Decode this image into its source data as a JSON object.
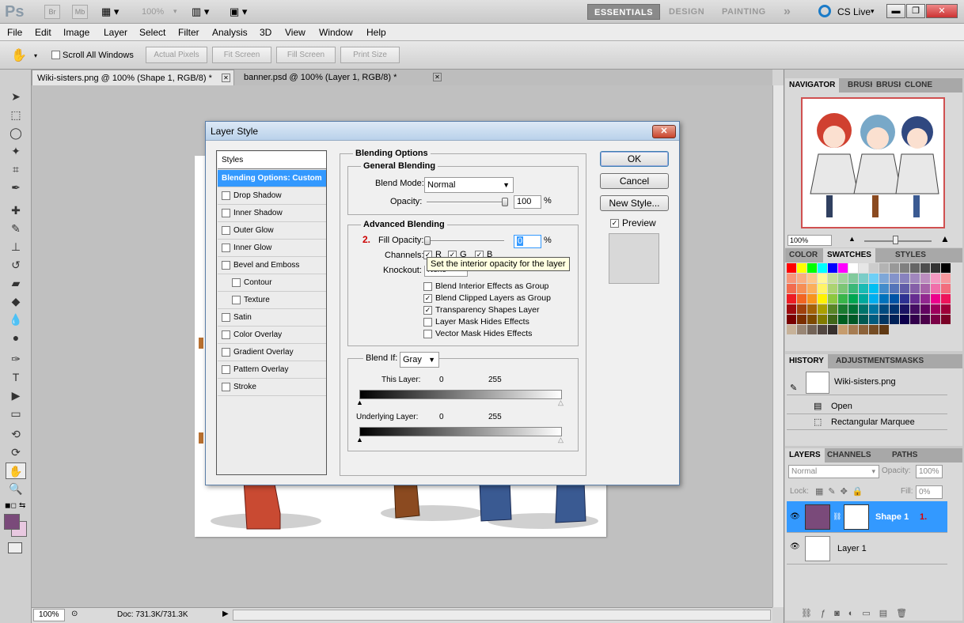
{
  "app": {
    "logo": "Ps",
    "br": "Br",
    "mb": "Mb",
    "zoom": "100%",
    "workspaces": [
      "ESSENTIALS",
      "DESIGN",
      "PAINTING"
    ],
    "more": "»",
    "cslive": "CS Live"
  },
  "menu": [
    "File",
    "Edit",
    "Image",
    "Layer",
    "Select",
    "Filter",
    "Analysis",
    "3D",
    "View",
    "Window",
    "Help"
  ],
  "options": {
    "scroll_all": "Scroll All Windows",
    "actual": "Actual Pixels",
    "fit": "Fit Screen",
    "fill": "Fill Screen",
    "print": "Print Size"
  },
  "tabs": [
    {
      "label": "Wiki-sisters.png @ 100% (Shape 1, RGB/8) *"
    },
    {
      "label": "banner.psd @ 100% (Layer 1, RGB/8) *"
    }
  ],
  "status": {
    "zoom": "100%",
    "doc": "Doc: 731.3K/731.3K"
  },
  "colors": {
    "accent": "#3399ff",
    "foreground": "#7a4a7a",
    "background": "#e8c8e0"
  },
  "panels": {
    "navigator": {
      "tabs": [
        "NAVIGATOR",
        "BRUSH",
        "BRUSH",
        "CLONE"
      ],
      "zoom": "100%"
    },
    "swatches": {
      "tabs": [
        "COLOR",
        "SWATCHES",
        "STYLES"
      ]
    },
    "history": {
      "tabs": [
        "HISTORY",
        "ADJUSTMENTS",
        "MASKS"
      ],
      "snapshot": "Wiki-sisters.png",
      "items": [
        "Open",
        "Rectangular Marquee"
      ]
    },
    "layers": {
      "tabs": [
        "LAYERS",
        "CHANNELS",
        "PATHS"
      ],
      "mode": "Normal",
      "opacity_label": "Opacity:",
      "opacity": "100%",
      "lock_label": "Lock:",
      "fill_label": "Fill:",
      "fill": "0%",
      "items": [
        {
          "name": "Shape 1",
          "marker": "1."
        },
        {
          "name": "Layer 1"
        }
      ]
    }
  },
  "dialog": {
    "title": "Layer Style",
    "close": "✕",
    "styles_header": "Styles",
    "styles": [
      {
        "label": "Blending Options: Custom",
        "selected": true,
        "checkbox": false
      },
      {
        "label": "Drop Shadow",
        "checkbox": true
      },
      {
        "label": "Inner Shadow",
        "checkbox": true
      },
      {
        "label": "Outer Glow",
        "checkbox": true
      },
      {
        "label": "Inner Glow",
        "checkbox": true
      },
      {
        "label": "Bevel and Emboss",
        "checkbox": true
      },
      {
        "label": "Contour",
        "checkbox": true,
        "indent": true
      },
      {
        "label": "Texture",
        "checkbox": true,
        "indent": true
      },
      {
        "label": "Satin",
        "checkbox": true
      },
      {
        "label": "Color Overlay",
        "checkbox": true
      },
      {
        "label": "Gradient Overlay",
        "checkbox": true
      },
      {
        "label": "Pattern Overlay",
        "checkbox": true
      },
      {
        "label": "Stroke",
        "checkbox": true
      }
    ],
    "blending_options": "Blending Options",
    "general": {
      "title": "General Blending",
      "blend_mode_label": "Blend Mode:",
      "blend_mode": "Normal",
      "opacity_label": "Opacity:",
      "opacity": "100",
      "pct": "%"
    },
    "advanced": {
      "title": "Advanced Blending",
      "marker": "2.",
      "fill_label": "Fill Opacity:",
      "fill_value": "0",
      "pct": "%",
      "channels_label": "Channels:",
      "channels": [
        "R",
        "G",
        "B"
      ],
      "knockout_label": "Knockout:",
      "knockout": "None",
      "options": [
        {
          "label": "Blend Interior Effects as Group",
          "checked": false
        },
        {
          "label": "Blend Clipped Layers as Group",
          "checked": true
        },
        {
          "label": "Transparency Shapes Layer",
          "checked": true
        },
        {
          "label": "Layer Mask Hides Effects",
          "checked": false
        },
        {
          "label": "Vector Mask Hides Effects",
          "checked": false
        }
      ]
    },
    "blendif": {
      "label": "Blend If:",
      "value": "Gray",
      "this_layer": "This Layer:",
      "underlying": "Underlying Layer:",
      "min": "0",
      "max": "255"
    },
    "tooltip": "Set the interior opacity for the layer",
    "buttons": {
      "ok": "OK",
      "cancel": "Cancel",
      "new_style": "New Style...",
      "preview": "Preview"
    }
  }
}
